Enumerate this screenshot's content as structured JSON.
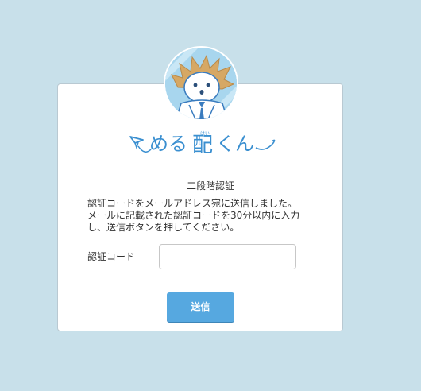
{
  "brand": {
    "name": "めるくん",
    "name_kanji": "配",
    "ruby": "はい"
  },
  "page": {
    "heading": "二段階認証",
    "message_lines": [
      "認証コードをメールアドレス宛に送信しました。",
      "メールに記載された認証コードを30分以内に入力",
      "し、送信ボタンを押してください。"
    ]
  },
  "form": {
    "code_label": "認証コード",
    "code_value": "",
    "code_placeholder": "",
    "submit_label": "送信"
  },
  "colors": {
    "page_background": "#c8e0ea",
    "brand_blue": "#56a8e0",
    "logo_blue": "#3a8fd0"
  },
  "icons": {
    "avatar": "mascot-avatar-icon",
    "paper_plane": "paper-plane-icon"
  }
}
